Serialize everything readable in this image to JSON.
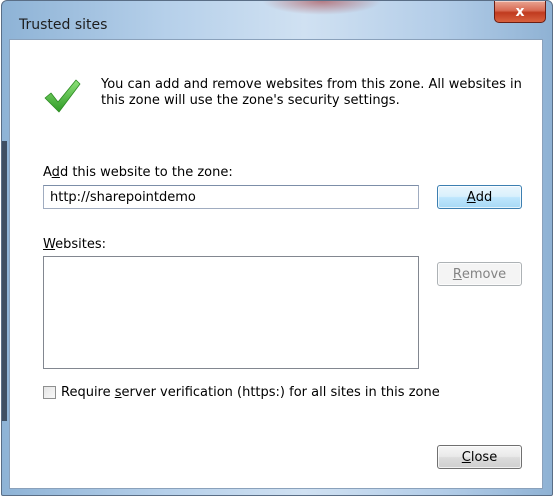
{
  "window": {
    "title": "Trusted sites",
    "close_glyph": "x"
  },
  "description": "You can add and remove websites from this zone. All websites in this zone will use the zone's security settings.",
  "add_section": {
    "label_before": "A",
    "label_accel": "d",
    "label_after": "d this website to the zone:",
    "input_value": "http://sharepointdemo",
    "add_accel": "A",
    "add_rest": "dd"
  },
  "websites_section": {
    "label_accel": "W",
    "label_rest": "ebsites:",
    "items": [],
    "remove_accel": "R",
    "remove_rest": "emove"
  },
  "verification": {
    "label_before": "Require ",
    "label_accel": "s",
    "label_after": "erver verification (https:) for all sites in this zone",
    "checked": false
  },
  "footer": {
    "close_accel": "C",
    "close_rest": "lose"
  },
  "icons": {
    "status": "green-checkmark-icon"
  },
  "colors": {
    "checkmark": "#3aa82e",
    "default_button_border": "#3c7fb1",
    "close_button": "#c03a1f"
  }
}
